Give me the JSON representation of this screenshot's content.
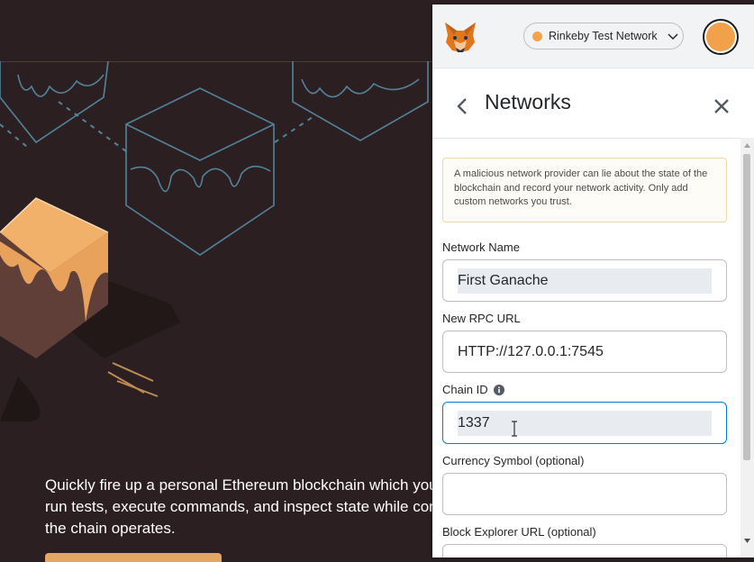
{
  "background": {
    "description_lines": [
      "Quickly fire up a personal Ethereum blockchain which you",
      "run tests, execute commands, and inspect state while con",
      "the chain operates."
    ]
  },
  "header": {
    "logo_icon": "metamask-fox-icon",
    "network_label": "Rinkeby Test Network",
    "network_dot_color": "#f6a24a",
    "account_color": "#f0a14a"
  },
  "page": {
    "title": "Networks"
  },
  "warning": {
    "text": "A malicious network provider can lie about the state of the blockchain and record your network activity. Only add custom networks you trust."
  },
  "form": {
    "network_name": {
      "label": "Network Name",
      "value": "First Ganache"
    },
    "rpc_url": {
      "label": "New RPC URL",
      "value": "HTTP://127.0.0.1:7545"
    },
    "chain_id": {
      "label": "Chain ID",
      "value": "1337"
    },
    "currency_symbol": {
      "label": "Currency Symbol (optional)",
      "value": ""
    },
    "block_explorer": {
      "label": "Block Explorer URL (optional)",
      "value": ""
    }
  },
  "colors": {
    "accent": "#037dd6",
    "ganache_orange": "#e4a663",
    "background": "#2b1f21"
  }
}
